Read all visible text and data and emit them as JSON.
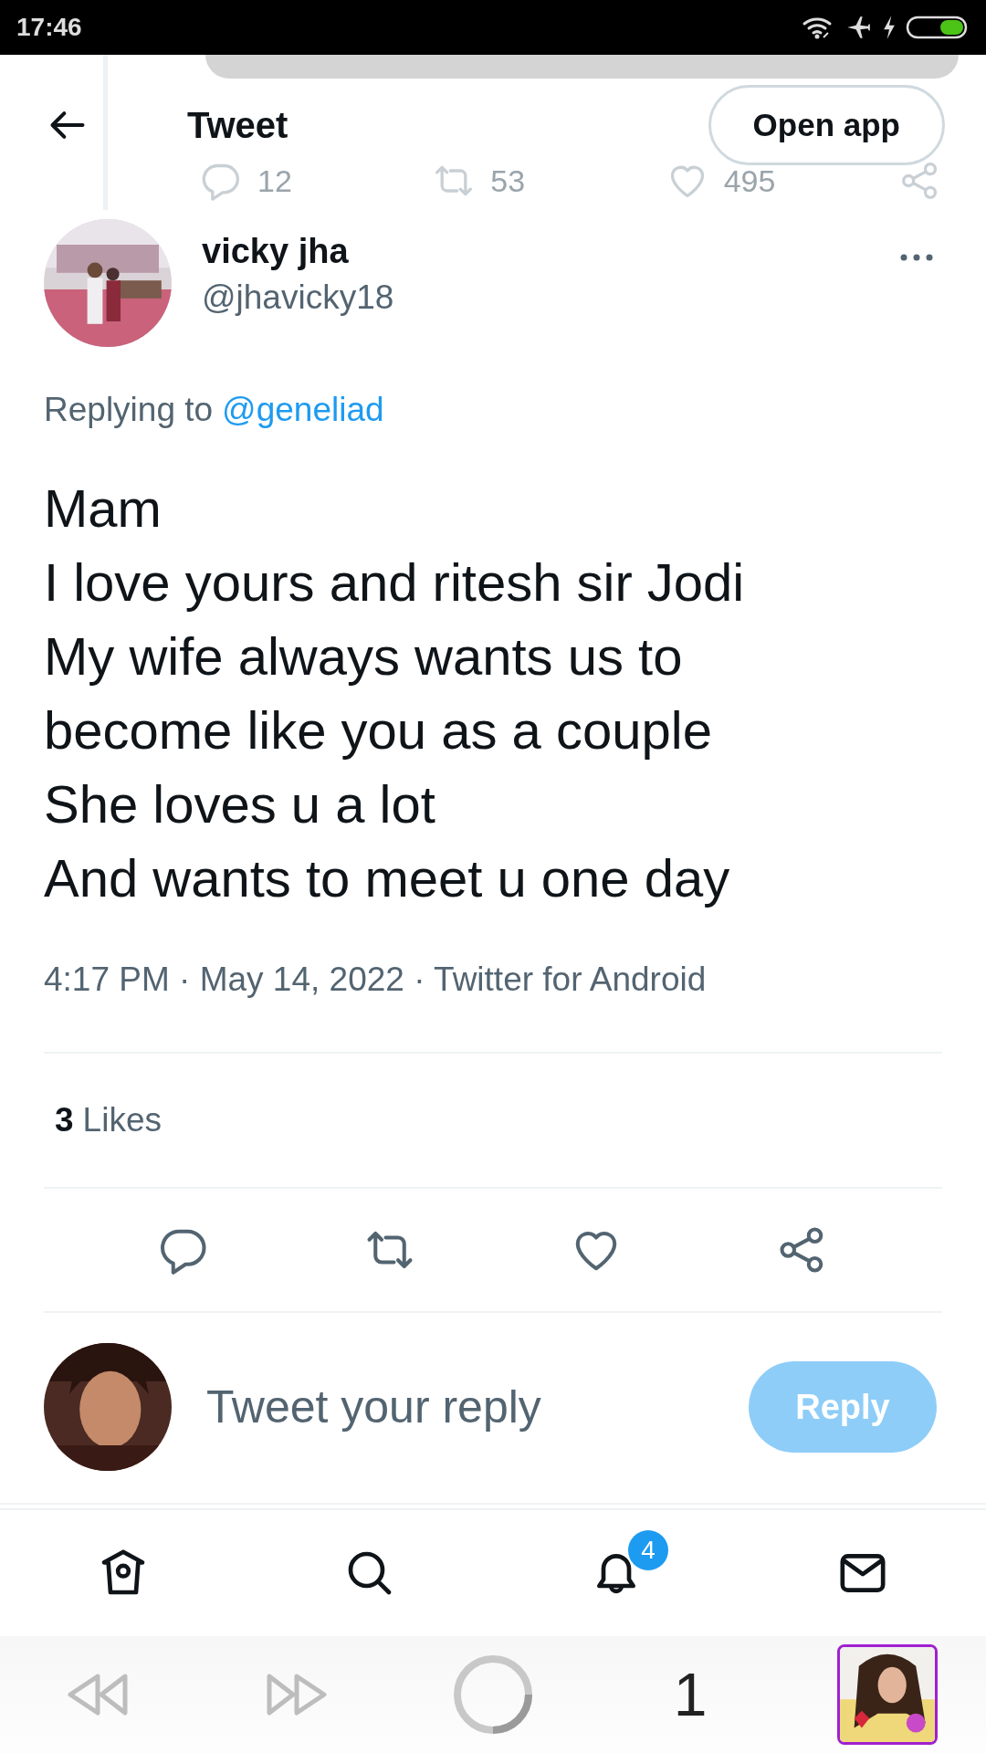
{
  "status_bar": {
    "time": "17:46"
  },
  "header": {
    "title": "Tweet",
    "open_app": "Open app",
    "behind_actions": [
      {
        "kind": "reply",
        "count": "12"
      },
      {
        "kind": "retweet",
        "count": "53"
      },
      {
        "kind": "like",
        "count": "495"
      },
      {
        "kind": "share"
      }
    ]
  },
  "tweet": {
    "author": "vicky jha",
    "handle": "@jhavicky18",
    "replying_prefix": "Replying to",
    "replying_to": "@geneliad",
    "lines": [
      "Mam",
      "I love yours and ritesh sir Jodi",
      "My wife always wants us to",
      "become like you as a couple",
      "She loves u a lot",
      "And wants to meet u one day"
    ],
    "meta": "4:17 PM · May 14, 2022 · Twitter for Android",
    "likes_count": "3",
    "likes_label": "Likes",
    "actions": [
      {
        "kind": "reply"
      },
      {
        "kind": "retweet"
      },
      {
        "kind": "like"
      },
      {
        "kind": "share"
      }
    ]
  },
  "reply": {
    "placeholder": "Tweet your reply",
    "button": "Reply",
    "disabled": true
  },
  "nav": [
    {
      "kind": "home"
    },
    {
      "kind": "search"
    },
    {
      "kind": "notifications",
      "badge": "4"
    },
    {
      "kind": "messages"
    }
  ],
  "browser_bar": {
    "back_disabled": true,
    "forward_disabled": true,
    "tab_count": "1"
  }
}
